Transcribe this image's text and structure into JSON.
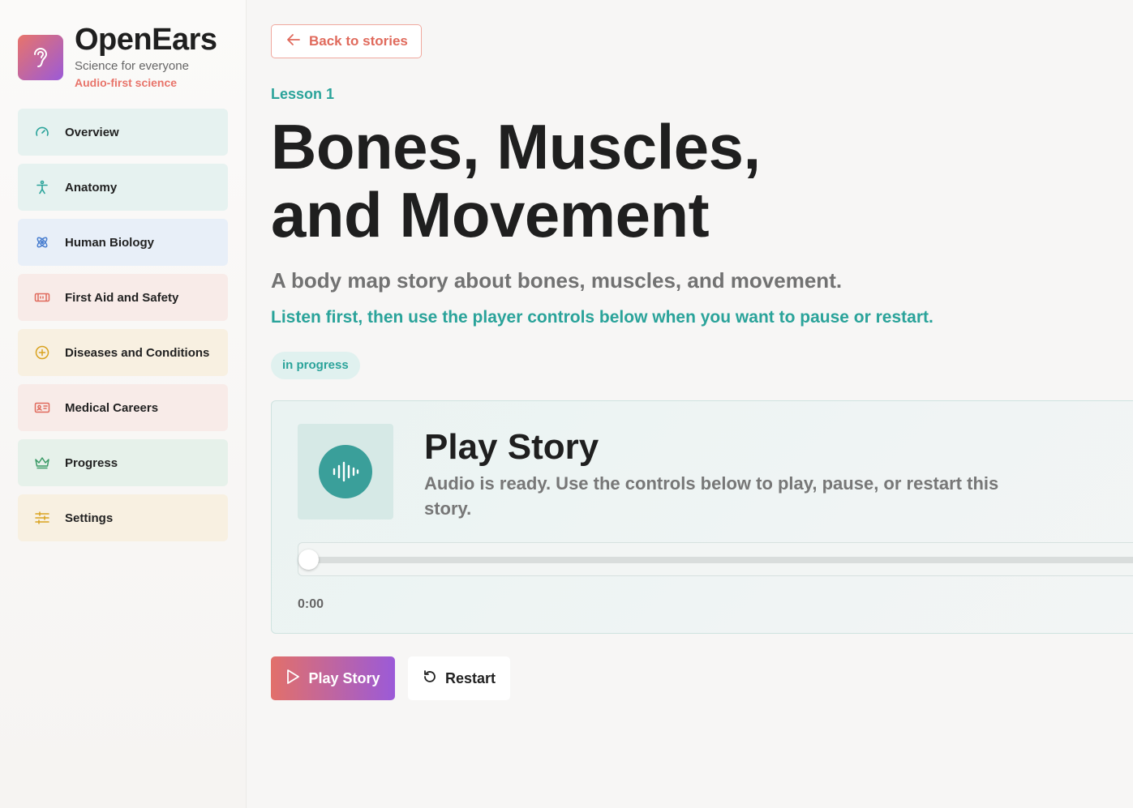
{
  "brand": {
    "name": "OpenEars",
    "subtitle": "Science for everyone",
    "tagline": "Audio-first science",
    "logo_icon": "ear-icon"
  },
  "sidebar": {
    "items": [
      {
        "label": "Overview",
        "icon": "gauge-icon",
        "color": "#2aa39a"
      },
      {
        "label": "Anatomy",
        "icon": "person-icon",
        "color": "#2aa39a"
      },
      {
        "label": "Human Biology",
        "icon": "atom-icon",
        "color": "#4a7fd0"
      },
      {
        "label": "First Aid and Safety",
        "icon": "first-aid-icon",
        "color": "#e06a5c"
      },
      {
        "label": "Diseases and Conditions",
        "icon": "plus-circle-icon",
        "color": "#d9a21f"
      },
      {
        "label": "Medical Careers",
        "icon": "id-card-icon",
        "color": "#e06a5c"
      },
      {
        "label": "Progress",
        "icon": "crown-icon",
        "color": "#3a9a66"
      },
      {
        "label": "Settings",
        "icon": "sliders-icon",
        "color": "#d9a21f"
      }
    ]
  },
  "main": {
    "back_label": "Back to stories",
    "lesson_label": "Lesson 1",
    "title": "Bones, Muscles, and Movement",
    "subtitle": "A body map story about bones, muscles, and movement.",
    "hint": "Listen first, then use the player controls below when you want to pause or restart.",
    "status": "in progress"
  },
  "player": {
    "title": "Play Story",
    "description": "Audio is ready. Use the controls below to play, pause, or restart this story.",
    "current_time": "0:00",
    "progress": 0
  },
  "controls": {
    "play_label": "Play Story",
    "restart_label": "Restart"
  },
  "colors": {
    "accent_teal": "#2aa39a",
    "accent_coral": "#e06a5c",
    "accent_purple": "#9b5ad8"
  }
}
